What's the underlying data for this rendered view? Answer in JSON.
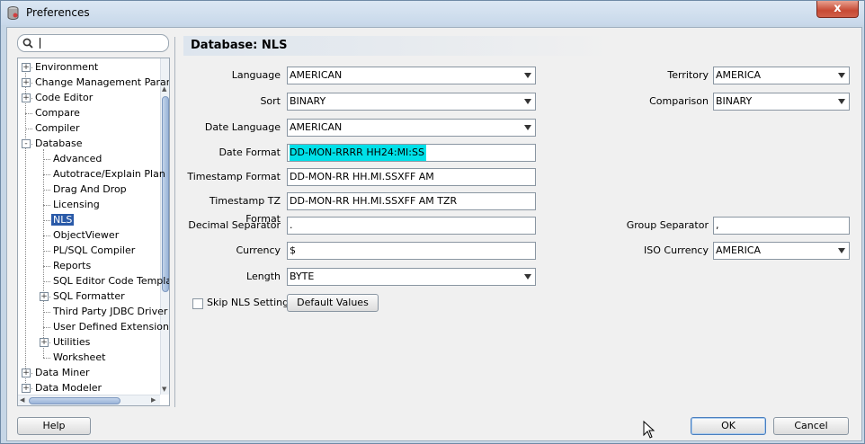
{
  "window": {
    "title": "Preferences",
    "close_label": "x"
  },
  "search": {
    "value": ""
  },
  "tree": {
    "items": [
      {
        "label": "Environment",
        "level": 0,
        "expander": "+"
      },
      {
        "label": "Change Management Paran",
        "level": 0,
        "expander": "+"
      },
      {
        "label": "Code Editor",
        "level": 0,
        "expander": "+"
      },
      {
        "label": "Compare",
        "level": 0,
        "expander": ""
      },
      {
        "label": "Compiler",
        "level": 0,
        "expander": ""
      },
      {
        "label": "Database",
        "level": 0,
        "expander": "-"
      },
      {
        "label": "Advanced",
        "level": 1,
        "expander": ""
      },
      {
        "label": "Autotrace/Explain Plan",
        "level": 1,
        "expander": ""
      },
      {
        "label": "Drag And Drop",
        "level": 1,
        "expander": ""
      },
      {
        "label": "Licensing",
        "level": 1,
        "expander": ""
      },
      {
        "label": "NLS",
        "level": 1,
        "expander": "",
        "selected": true
      },
      {
        "label": "ObjectViewer",
        "level": 1,
        "expander": ""
      },
      {
        "label": "PL/SQL Compiler",
        "level": 1,
        "expander": ""
      },
      {
        "label": "Reports",
        "level": 1,
        "expander": ""
      },
      {
        "label": "SQL Editor Code Templa",
        "level": 1,
        "expander": ""
      },
      {
        "label": "SQL Formatter",
        "level": 1,
        "expander": "+"
      },
      {
        "label": "Third Party JDBC Driver",
        "level": 1,
        "expander": ""
      },
      {
        "label": "User Defined Extension",
        "level": 1,
        "expander": ""
      },
      {
        "label": "Utilities",
        "level": 1,
        "expander": "+"
      },
      {
        "label": "Worksheet",
        "level": 1,
        "expander": ""
      },
      {
        "label": "Data Miner",
        "level": 0,
        "expander": "+"
      },
      {
        "label": "Data Modeler",
        "level": 0,
        "expander": "+"
      }
    ]
  },
  "panel": {
    "title": "Database: NLS",
    "language": {
      "label": "Language",
      "value": "AMERICAN"
    },
    "territory": {
      "label": "Territory",
      "value": "AMERICA"
    },
    "sort": {
      "label": "Sort",
      "value": "BINARY"
    },
    "comparison": {
      "label": "Comparison",
      "value": "BINARY"
    },
    "date_language": {
      "label": "Date Language",
      "value": "AMERICAN"
    },
    "date_format": {
      "label": "Date Format",
      "value": "DD-MON-RRRR HH24:MI:SS"
    },
    "timestamp_format": {
      "label": "Timestamp Format",
      "value": "DD-MON-RR HH.MI.SSXFF AM"
    },
    "timestamp_tz_format": {
      "label": "Timestamp TZ Format",
      "value": "DD-MON-RR HH.MI.SSXFF AM TZR"
    },
    "decimal_separator": {
      "label": "Decimal Separator",
      "value": "."
    },
    "group_separator": {
      "label": "Group Separator",
      "value": ","
    },
    "currency": {
      "label": "Currency",
      "value": "$"
    },
    "iso_currency": {
      "label": "ISO Currency",
      "value": "AMERICA"
    },
    "length": {
      "label": "Length",
      "value": "BYTE"
    },
    "skip_nls": {
      "label": "Skip NLS Settings",
      "checked": false
    },
    "default_values_label": "Default Values"
  },
  "footer": {
    "help_label": "Help",
    "ok_label": "OK",
    "cancel_label": "Cancel"
  }
}
